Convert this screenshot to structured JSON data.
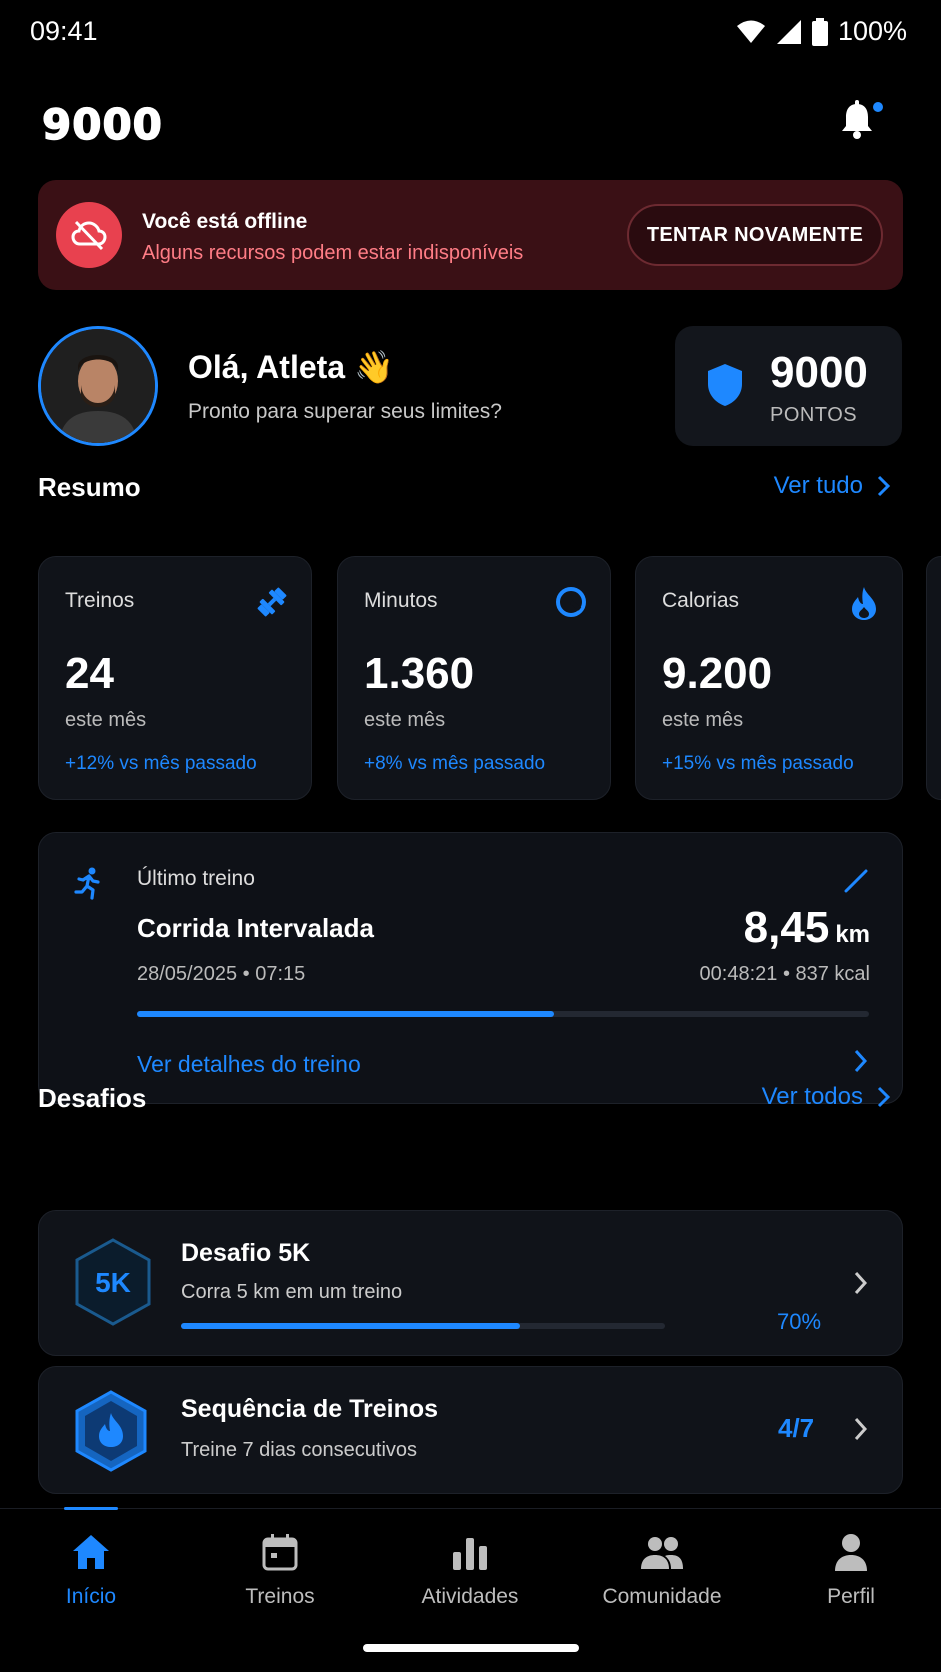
{
  "status": {
    "time": "09:41",
    "battery": "100%"
  },
  "header": {
    "logo": "9000",
    "icons": [
      "bell-icon"
    ]
  },
  "offline": {
    "title": "Você está offline",
    "message": "Alguns recursos podem estar indisponíveis",
    "retry": "TENTAR NOVAMENTE"
  },
  "user": {
    "greeting": "Olá, Atleta 👋",
    "subtitle": "Pronto para superar seus limites?",
    "points": "9000",
    "points_label": "PONTOS"
  },
  "summary": {
    "title": "Resumo",
    "link": "Ver tudo",
    "cards": [
      {
        "label": "Treinos",
        "value": "24",
        "period": "este mês",
        "compare": "+12% vs mês passado",
        "icon": "dumbbell-icon"
      },
      {
        "label": "Minutos",
        "value": "1.360",
        "period": "este mês",
        "compare": "+8% vs mês passado",
        "icon": "clock-ring-icon"
      },
      {
        "label": "Calorias",
        "value": "9.200",
        "period": "este mês",
        "compare": "+15% vs mês passado",
        "icon": "flame-icon"
      }
    ]
  },
  "last_workout": {
    "label": "Último treino",
    "name": "Corrida Intervalada",
    "date": "28/05/2025 • 07:15",
    "distance": "8,45",
    "unit": "km",
    "meta": "00:48:21  • 837 kcal",
    "progress": 0.57,
    "details_link": "Ver detalhes do treino"
  },
  "challenges": {
    "title": "Desafios",
    "link": "Ver todos",
    "items": [
      {
        "badge": "5K",
        "title": "Desafio 5K",
        "desc": "Corra 5 km em um treino",
        "progress_text": "70%",
        "progress": 0.7
      },
      {
        "title": "Sequência de Treinos",
        "desc": "Treine 7 dias consecutivos",
        "progress_text": "4/7"
      }
    ]
  },
  "nav": {
    "items": [
      {
        "label": "Início",
        "icon": "home-icon",
        "active": true
      },
      {
        "label": "Treinos",
        "icon": "calendar-icon"
      },
      {
        "label": "Atividades",
        "icon": "bar-chart-icon"
      },
      {
        "label": "Comunidade",
        "icon": "people-icon"
      },
      {
        "label": "Perfil",
        "icon": "person-icon"
      }
    ]
  },
  "colors": {
    "accent": "#1e88ff",
    "danger": "#e8414f",
    "background": "#000000",
    "card": "#101319"
  }
}
